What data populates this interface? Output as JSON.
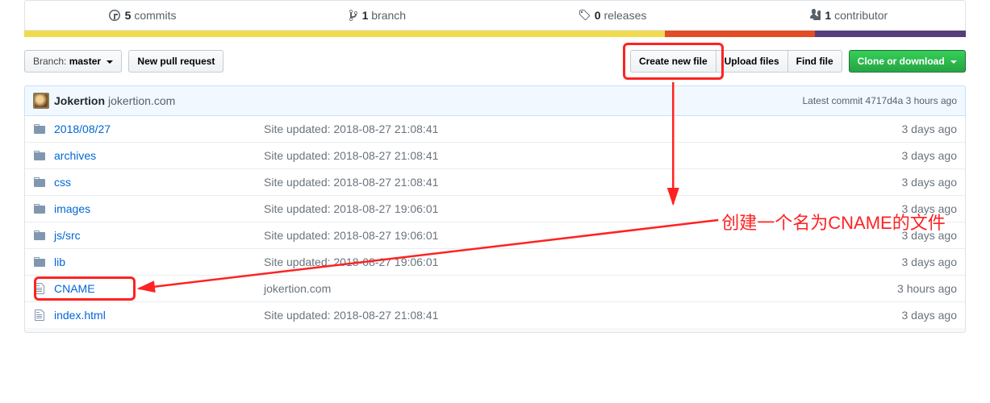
{
  "stats": {
    "commits_count": "5",
    "commits_label": "commits",
    "branches_count": "1",
    "branches_label": "branch",
    "releases_count": "0",
    "releases_label": "releases",
    "contributors_count": "1",
    "contributors_label": "contributor"
  },
  "colorbar": [
    {
      "color": "#f0db4f",
      "width": "68%"
    },
    {
      "color": "#e34c26",
      "width": "16%"
    },
    {
      "color": "#563d7c",
      "width": "16%"
    }
  ],
  "toolbar": {
    "branch_prefix": "Branch:",
    "branch_name": "master",
    "new_pr": "New pull request",
    "create_file": "Create new file",
    "upload_files": "Upload files",
    "find_file": "Find file",
    "clone": "Clone or download"
  },
  "commit_tease": {
    "author": "Jokertion",
    "message": "jokertion.com",
    "latest_label": "Latest commit",
    "sha": "4717d4a",
    "age": "3 hours ago"
  },
  "files": [
    {
      "type": "dir",
      "name": "2018/08/27",
      "msg": "Site updated: 2018-08-27 21:08:41",
      "age": "3 days ago"
    },
    {
      "type": "dir",
      "name": "archives",
      "msg": "Site updated: 2018-08-27 21:08:41",
      "age": "3 days ago"
    },
    {
      "type": "dir",
      "name": "css",
      "msg": "Site updated: 2018-08-27 21:08:41",
      "age": "3 days ago"
    },
    {
      "type": "dir",
      "name": "images",
      "msg": "Site updated: 2018-08-27 19:06:01",
      "age": "3 days ago"
    },
    {
      "type": "dir",
      "name": "js/src",
      "msg": "Site updated: 2018-08-27 19:06:01",
      "age": "3 days ago"
    },
    {
      "type": "dir",
      "name": "lib",
      "msg": "Site updated: 2018-08-27 19:06:01",
      "age": "3 days ago"
    },
    {
      "type": "file",
      "name": "CNAME",
      "msg": "jokertion.com",
      "age": "3 hours ago"
    },
    {
      "type": "file",
      "name": "index.html",
      "msg": "Site updated: 2018-08-27 21:08:41",
      "age": "3 days ago"
    }
  ],
  "annotation": "创建一个名为CNAME的文件"
}
